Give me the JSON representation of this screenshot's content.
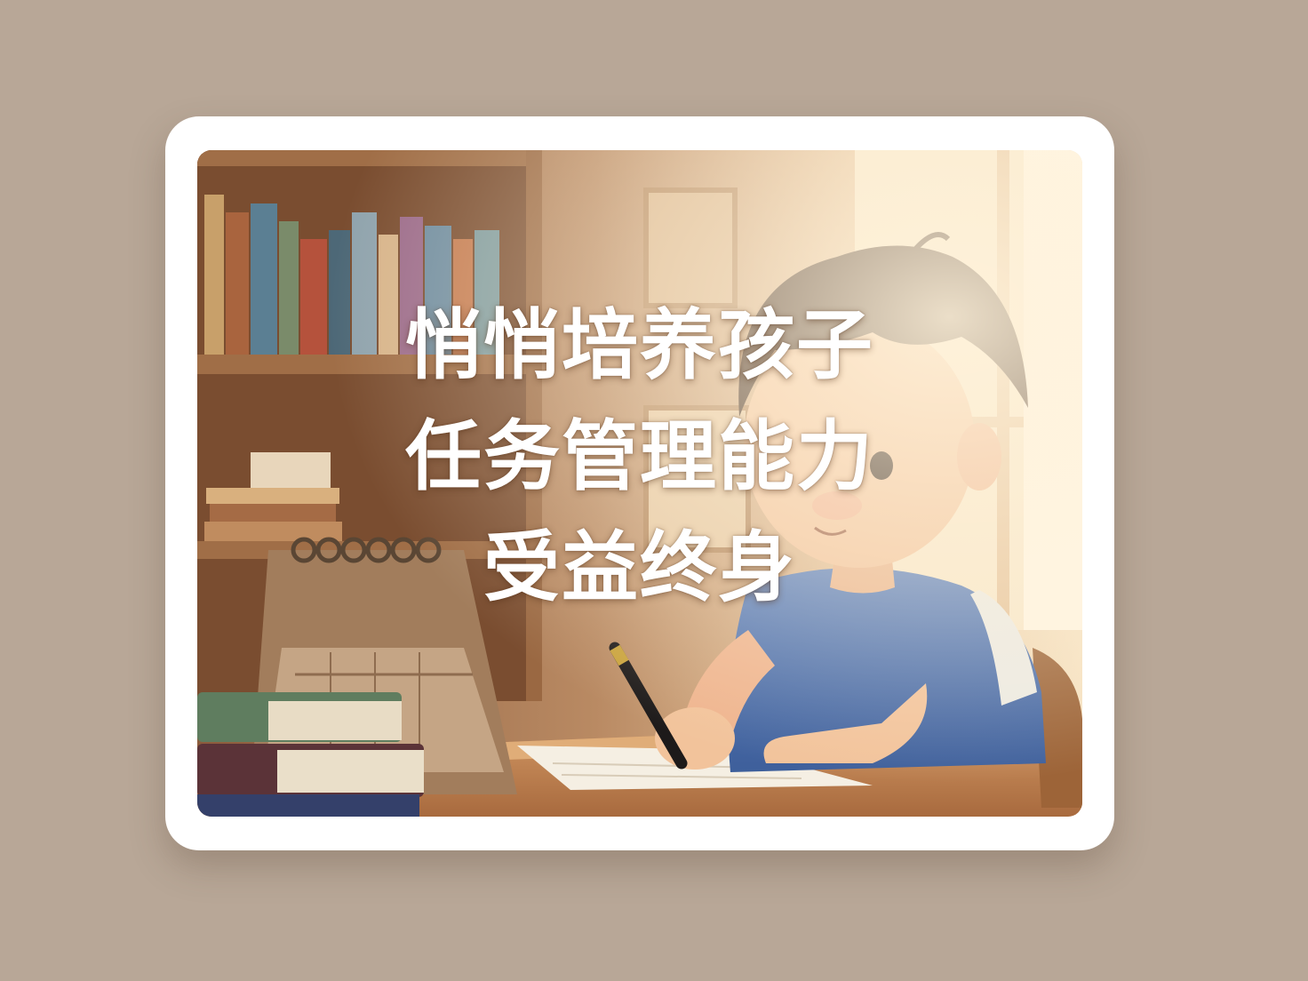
{
  "caption": {
    "line1": "悄悄培养孩子",
    "line2": "任务管理能力",
    "line3": "受益终身"
  },
  "colors": {
    "page_background": "#b8a797",
    "card_frame": "#ffffff",
    "caption_text": "#ffffff",
    "shirt": "#4a6fae",
    "hair": "#3a2418",
    "room_light": "#f3d9b4"
  },
  "illustration": {
    "subjects": [
      "bookshelf-icon",
      "desk-calendar-icon",
      "book-stack-icon",
      "boy-icon",
      "pen-icon",
      "notebook-icon",
      "window-icon",
      "chair-icon"
    ]
  }
}
